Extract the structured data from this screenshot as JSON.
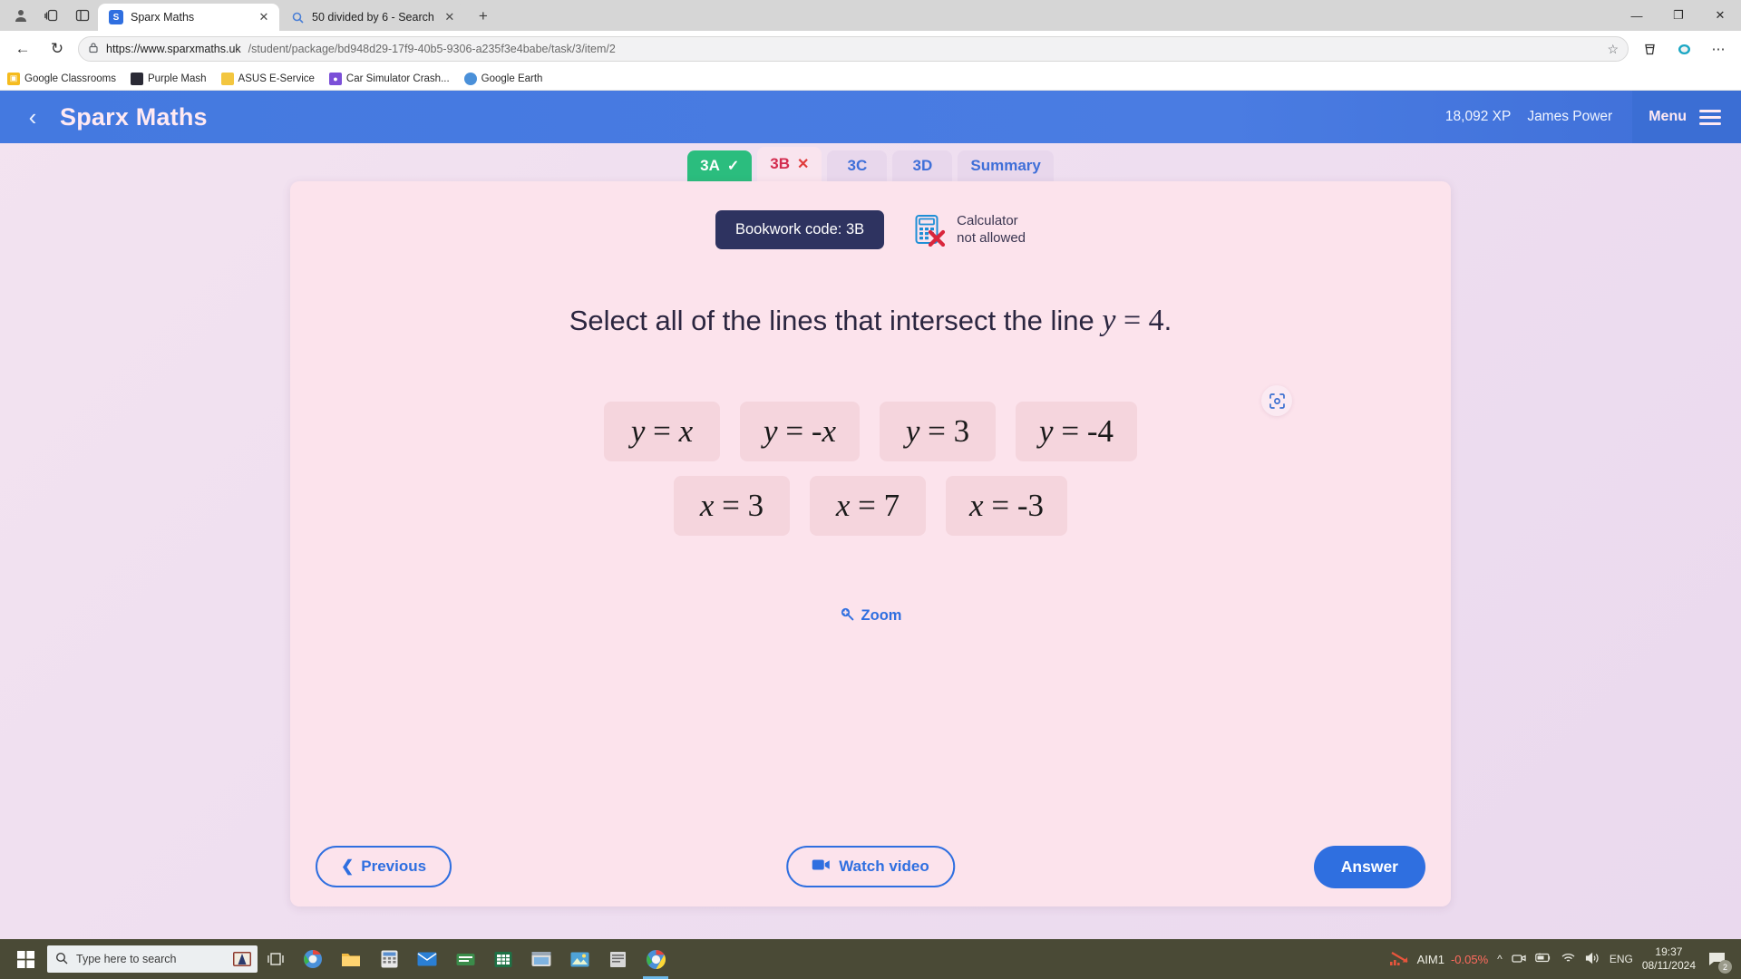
{
  "browser": {
    "tabs": [
      {
        "title": "Sparx Maths",
        "favicon": "sparx-s-icon",
        "active": true
      },
      {
        "title": "50 divided by 6 - Search",
        "favicon": "search-icon",
        "active": false
      }
    ],
    "new_tab_label": "+",
    "window_controls": {
      "minimize": "—",
      "maximize": "❐",
      "close": "✕"
    },
    "nav": {
      "back": "←",
      "reload": "↻"
    },
    "url": {
      "lock": "🔒",
      "domain": "https://www.sparxmaths.uk",
      "path": "/student/package/bd948d29-17f9-40b5-9306-a235f3e4babe/task/3/item/2",
      "star": "☆"
    },
    "bookmarks": [
      {
        "label": "Google Classrooms",
        "color": "#f5bb1e"
      },
      {
        "label": "Purple Mash",
        "color": "#2a2a35"
      },
      {
        "label": "ASUS E-Service",
        "color": "#f3c63f"
      },
      {
        "label": "Car Simulator Crash...",
        "color": "#7b4fd8"
      },
      {
        "label": "Google Earth",
        "color": "#4a90d9"
      }
    ]
  },
  "app": {
    "brand": "Sparx Maths",
    "back_icon": "‹",
    "xp": "18,092 XP",
    "username": "James Power",
    "menu_label": "Menu",
    "tabs": [
      {
        "label": "3A",
        "mark": "✓",
        "state": "done"
      },
      {
        "label": "3B",
        "mark": "✕",
        "state": "current"
      },
      {
        "label": "3C",
        "mark": "",
        "state": "todo"
      },
      {
        "label": "3D",
        "mark": "",
        "state": "todo"
      },
      {
        "label": "Summary",
        "mark": "",
        "state": "todo"
      }
    ],
    "bookwork_code": "Bookwork code: 3B",
    "calculator": {
      "line1": "Calculator",
      "line2": "not allowed"
    },
    "question": {
      "prefix": "Select all of the lines that intersect the line ",
      "math_var": "y",
      "math_eq": " = ",
      "math_val": "4",
      "suffix": "."
    },
    "options_row1": [
      {
        "lhs": "y",
        "op": " = ",
        "rhs": "x",
        "rhs_italic": true
      },
      {
        "lhs": "y",
        "op": " = ",
        "rhs": "-x",
        "rhs_italic": true
      },
      {
        "lhs": "y",
        "op": " = ",
        "rhs": "3",
        "rhs_italic": false
      },
      {
        "lhs": "y",
        "op": " = ",
        "rhs": "-4",
        "rhs_italic": false
      }
    ],
    "options_row2": [
      {
        "lhs": "x",
        "op": " = ",
        "rhs": "3",
        "rhs_italic": false
      },
      {
        "lhs": "x",
        "op": " = ",
        "rhs": "7",
        "rhs_italic": false
      },
      {
        "lhs": "x",
        "op": " = ",
        "rhs": "-3",
        "rhs_italic": false
      }
    ],
    "zoom_label": "Zoom",
    "footer": {
      "previous": "Previous",
      "watch_video": "Watch video",
      "answer": "Answer"
    },
    "colors": {
      "accent_blue": "#2f6fe0",
      "header_blue": "#4479e0",
      "done_green": "#2bbd7e",
      "current_red": "#d32b4e",
      "bookwork_navy": "#2e3360",
      "card_pink": "#fce3ec",
      "option_pink": "#f5d5dd"
    }
  },
  "taskbar": {
    "search_placeholder": "Type here to search",
    "tray": {
      "stock_name": "AIM1",
      "stock_change": "-0.05%",
      "language": "ENG",
      "time": "19:37",
      "date": "08/11/2024",
      "notification_count": "2"
    }
  }
}
